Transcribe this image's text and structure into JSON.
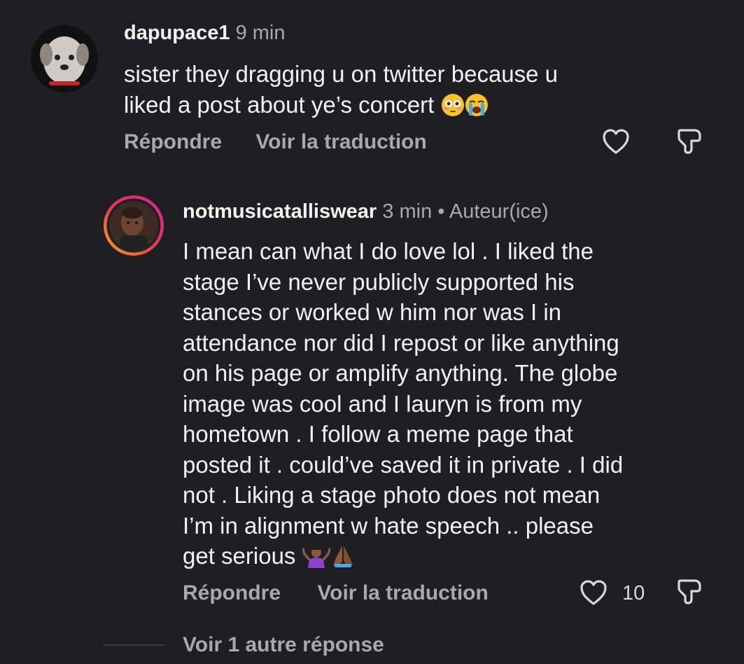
{
  "comment1": {
    "username": "dapupace1",
    "time": "9 min",
    "lines": [
      "sister they dragging u on twitter because u",
      "liked a post about ye’s concert"
    ],
    "reply_label": "Répondre",
    "translate_label": "Voir la traduction"
  },
  "comment2": {
    "username": "notmusicatalliswear",
    "time": "3 min",
    "separator": "•",
    "author_tag": "Auteur(ice)",
    "lines": [
      "I mean can what  I do love lol . I liked the",
      "stage I’ve never publicly supported his",
      "stances or worked w him nor was I in",
      "attendance nor did I repost or like anything",
      "on his page or amplify anything. The globe",
      "image was cool and I lauryn is from my",
      "hometown . I follow a meme page that",
      "posted it . could’ve saved it in private . I did",
      "not . Liking a stage photo does not mean",
      "I’m in alignment w hate speech .. please",
      "get serious"
    ],
    "reply_label": "Répondre",
    "translate_label": "Voir la traduction",
    "like_count": "10"
  },
  "more_replies": "Voir 1 autre réponse",
  "icons": {
    "emoji1": "flushed-face",
    "emoji2": "loudly-crying-face",
    "emoji3": "person-shrugging",
    "emoji4": "folded-hands",
    "like": "heart-outline-icon",
    "dislike": "thumbs-down-outline-icon"
  },
  "colors": {
    "background": "#1f1f23",
    "text": "#f2f2f2",
    "muted": "#a8a8ad",
    "story_ring_start": "#f5a623",
    "story_ring_end": "#d6249f"
  }
}
